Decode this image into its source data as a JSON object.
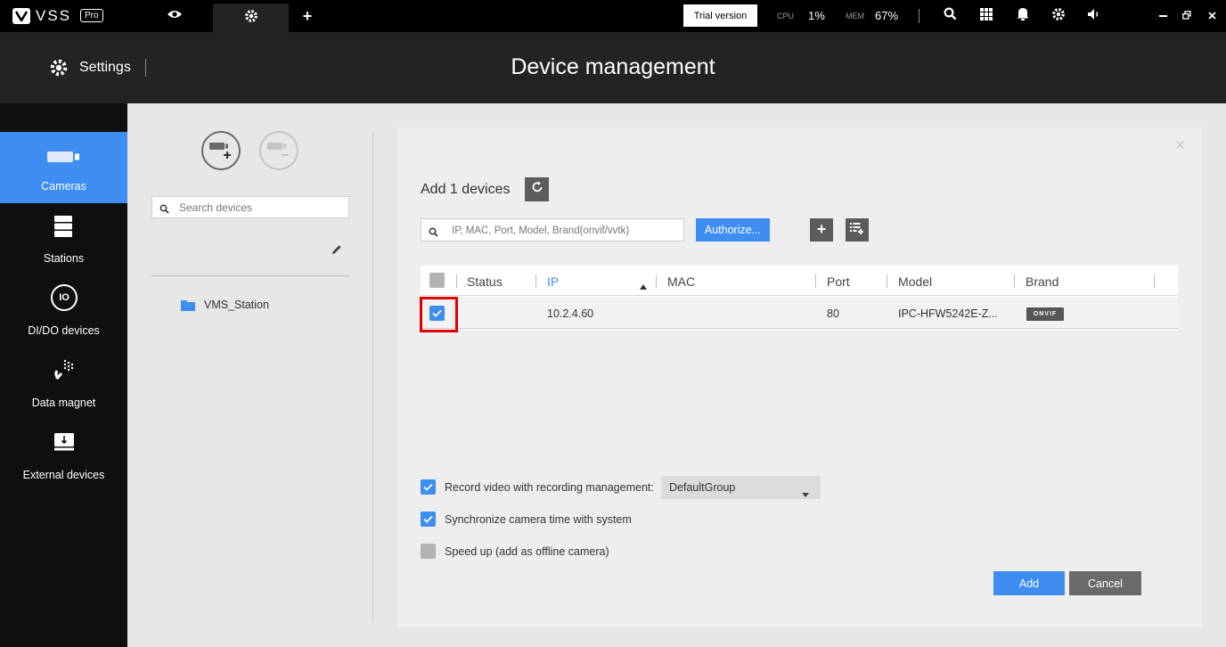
{
  "app": {
    "logo_text": "VSS",
    "edition": "Pro"
  },
  "topbar": {
    "trial_label": "Trial version",
    "cpu_label": "CPU",
    "cpu_value": "1%",
    "mem_label": "MEM",
    "mem_value": "67%"
  },
  "header": {
    "settings_label": "Settings",
    "page_title": "Device management"
  },
  "sidebar": {
    "items": [
      {
        "label": "Cameras"
      },
      {
        "label": "Stations"
      },
      {
        "label": "DI/DO devices"
      },
      {
        "label": "Data magnet"
      },
      {
        "label": "External devices"
      }
    ],
    "io_glyph": "IO"
  },
  "left_panel": {
    "search_placeholder": "Search devices",
    "tree": [
      {
        "label": "VMS_Station"
      }
    ]
  },
  "dialog": {
    "title": "Add 1 devices",
    "close_glyph": "×",
    "filter_placeholder": "IP, MAC, Port, Model, Brand(onvif/vvtk)",
    "authorize_label": "Authorize...",
    "columns": [
      "Status",
      "IP",
      "MAC",
      "Port",
      "Model",
      "Brand"
    ],
    "rows": [
      {
        "status": "",
        "ip": "10.2.4.60",
        "mac": "",
        "port": "80",
        "model": "IPC-HFW5242E-Z...",
        "brand": "ONVIF"
      }
    ],
    "options": [
      {
        "label": "Record video with recording management:",
        "checked": true
      },
      {
        "label": "Synchronize camera time with system",
        "checked": true
      },
      {
        "label": "Speed up (add as offline camera)",
        "checked": false
      }
    ],
    "group_select_value": "DefaultGroup",
    "add_label": "Add",
    "cancel_label": "Cancel"
  },
  "colors": {
    "accent": "#3d8ef0",
    "highlight": "#e00000",
    "topbar": "#000000",
    "sidebar": "#0f0f0f"
  }
}
